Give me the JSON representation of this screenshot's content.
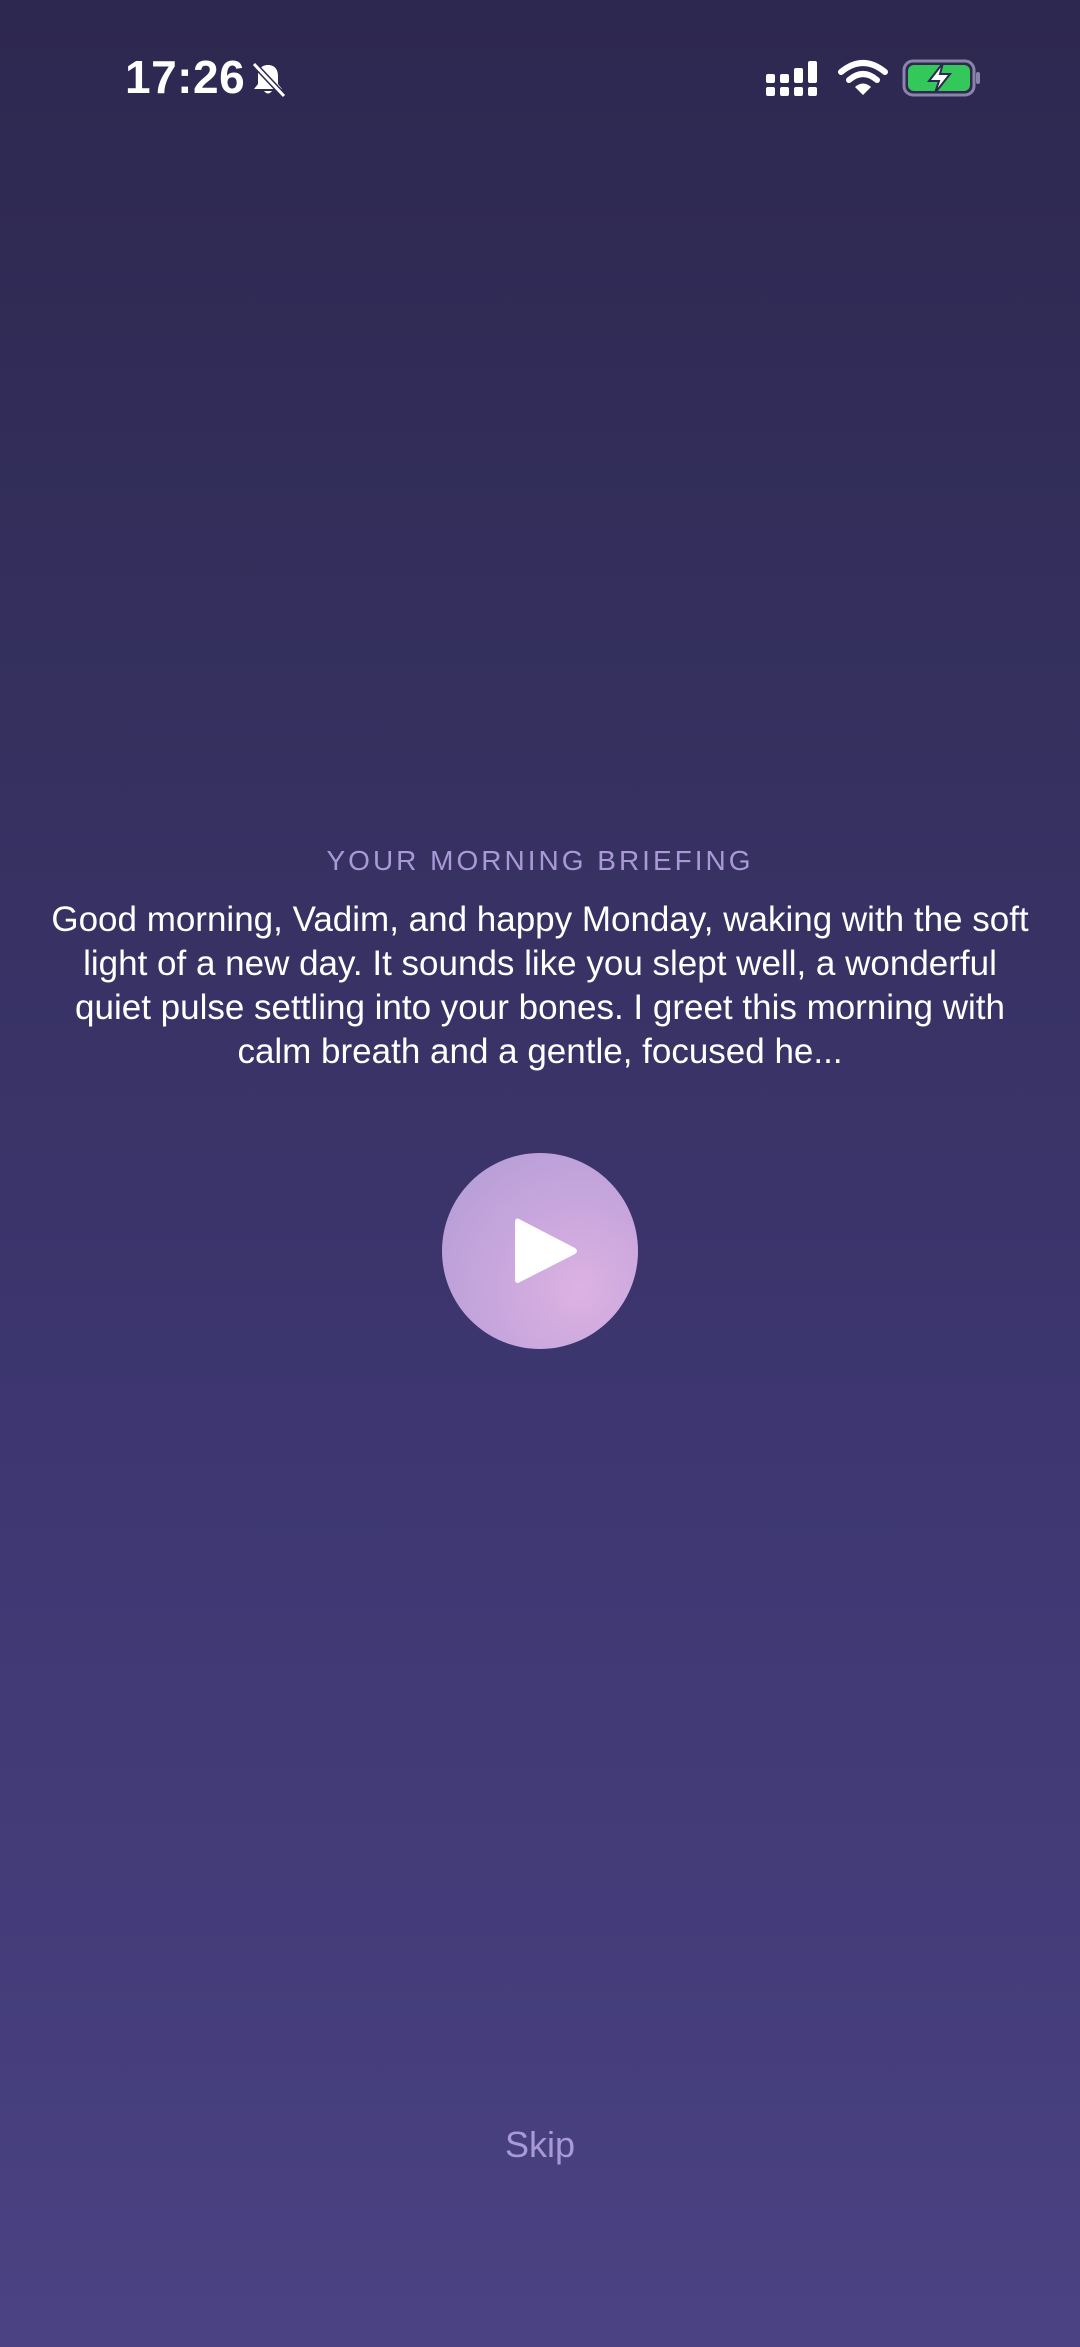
{
  "status_bar": {
    "time": "17:26",
    "icons": [
      "bell-slash-icon",
      "cellular-signal-icon",
      "wifi-icon",
      "battery-charging-icon"
    ],
    "battery_color": "#34c759"
  },
  "briefing": {
    "heading": "YOUR MORNING BRIEFING",
    "text": "Good morning, Vadim, and happy Monday, waking with the soft light of a new day. It sounds like you slept well, a wonderful quiet pulse settling into your bones. I greet this morning with calm breath and a gentle, focused he..."
  },
  "player": {
    "icon": "play-icon"
  },
  "actions": {
    "skip_label": "Skip"
  },
  "colors": {
    "background_top": "#2d2850",
    "background_bottom": "#4a4282",
    "accent_text": "#a999d6",
    "play_button": "#c8a6dd"
  }
}
